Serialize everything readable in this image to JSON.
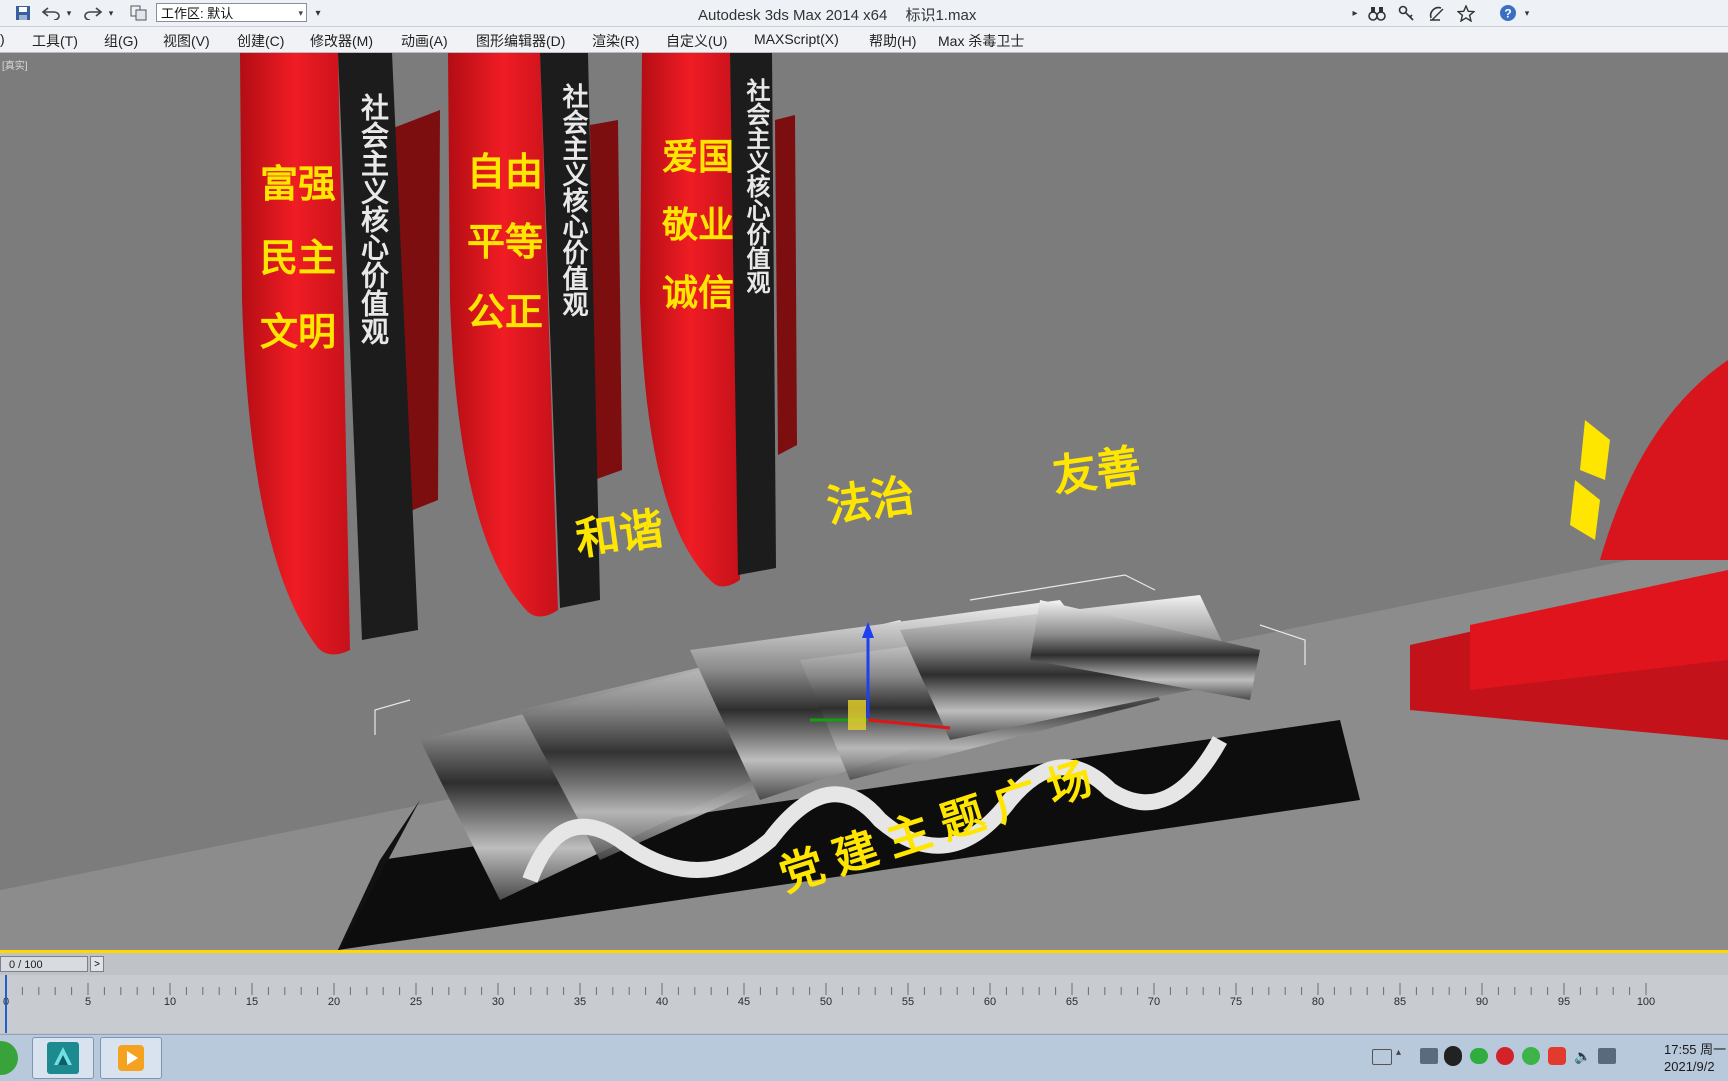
{
  "app": {
    "title": "Autodesk 3ds Max  2014 x64",
    "file": "标识1.max",
    "workspace": "工作区: 默认"
  },
  "menu": [
    "工具(T)",
    "组(G)",
    "视图(V)",
    "创建(C)",
    "修改器(M)",
    "动画(A)",
    "图形编辑器(D)",
    "渲染(R)",
    "自定义(U)",
    "MAXScript(X)",
    "帮助(H)",
    "Max 杀毒卫士"
  ],
  "viewport": {
    "label": "[真实]",
    "boards": [
      {
        "red_text": [
          "富强",
          "民主",
          "文明"
        ],
        "black_text": [
          "社会主义",
          "核心",
          "价值观"
        ]
      },
      {
        "red_text": [
          "自由",
          "平等",
          "公正"
        ],
        "black_text": [
          "社会主义",
          "核心",
          "价值观"
        ]
      },
      {
        "red_text": [
          "爱国",
          "敬业",
          "诚信"
        ],
        "black_text": [
          "社会主义",
          "核心",
          "价值观"
        ]
      }
    ],
    "floating_text": [
      "和谐",
      "法治",
      "友善"
    ],
    "base_text": "党 建 主 题 广 场"
  },
  "timeline": {
    "frame": "0 / 100",
    "next": ">",
    "ticks": [
      "0",
      "5",
      "10",
      "15",
      "20",
      "25",
      "30",
      "35",
      "40",
      "45",
      "50",
      "55",
      "60",
      "65",
      "70",
      "75",
      "80",
      "85",
      "90",
      "95",
      "100"
    ]
  },
  "clock": {
    "time": "17:55 周一",
    "date": "2021/9/2"
  },
  "colors": {
    "board_red": "#e8141e",
    "text_yellow": "#ffe600",
    "black_panel": "#1b1b1b",
    "timeline_accent": "#ffd800"
  }
}
